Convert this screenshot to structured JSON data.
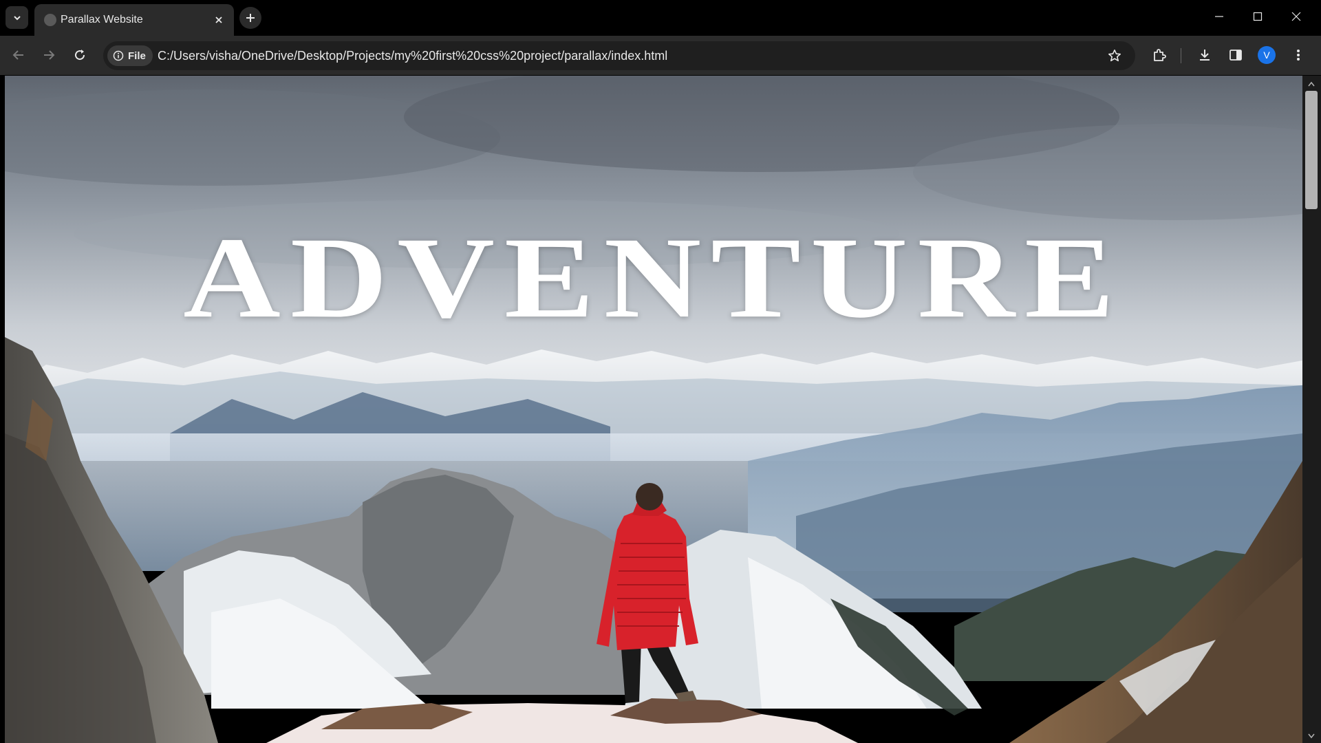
{
  "tab": {
    "title": "Parallax Website"
  },
  "address": {
    "chip_label": "File",
    "url": "C:/Users/visha/OneDrive/Desktop/Projects/my%20first%20css%20project/parallax/index.html"
  },
  "profile": {
    "initial": "V"
  },
  "page": {
    "headline": "ADVENTURE"
  },
  "colors": {
    "jacket": "#d8222b",
    "profile": "#1a73e8",
    "toolbar": "#2b2b2b"
  },
  "icons": [
    "tab-search-icon",
    "globe-favicon-icon",
    "close-icon",
    "plus-icon",
    "minimize-icon",
    "maximize-icon",
    "window-close-icon",
    "back-arrow-icon",
    "forward-arrow-icon",
    "reload-icon",
    "info-icon",
    "star-icon",
    "extensions-icon",
    "download-icon",
    "sidepanel-icon",
    "more-vert-icon"
  ]
}
